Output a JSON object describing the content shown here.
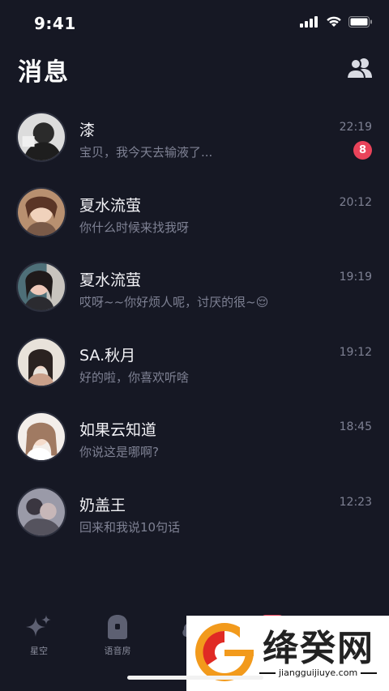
{
  "status_bar": {
    "time": "9:41"
  },
  "header": {
    "title": "消息",
    "contacts_icon": "contacts-icon"
  },
  "conversations": [
    {
      "name": "漆",
      "preview": "宝贝，我今天去输液了...",
      "time": "22:19",
      "unread": "8"
    },
    {
      "name": "夏水流萤",
      "preview": "你什么时候来找我呀",
      "time": "20:12"
    },
    {
      "name": "夏水流萤",
      "preview": "哎呀~~你好烦人呢，讨厌的很~😌",
      "time": "19:19"
    },
    {
      "name": "SA.秋月",
      "preview": "好的啦，你喜欢听啥",
      "time": "19:12"
    },
    {
      "name": "如果云知道",
      "preview": "你说这是哪啊?",
      "time": "18:45"
    },
    {
      "name": "奶盖王",
      "preview": "回来和我说10句话",
      "time": "12:23"
    }
  ],
  "tabbar": {
    "tabs": [
      {
        "label": "星空",
        "icon": "sparkle-icon"
      },
      {
        "label": "语音房",
        "icon": "voice-room-icon"
      },
      {
        "label": "",
        "icon": "cloud-icon"
      },
      {
        "label": "",
        "icon": "message-icon",
        "active": true
      },
      {
        "label": "",
        "icon": "profile-icon"
      }
    ]
  },
  "watermark": {
    "title": "绛癸网",
    "url": "jiangguijiuye.com"
  },
  "colors": {
    "background": "#161824",
    "badge": "#e9435a",
    "muted_text": "#7e8193"
  }
}
